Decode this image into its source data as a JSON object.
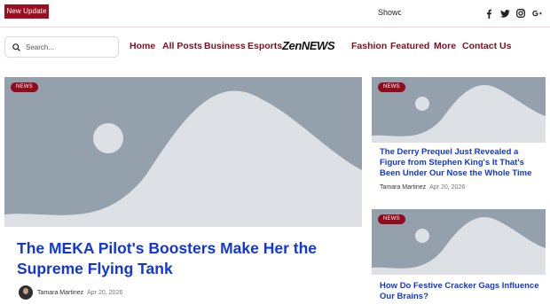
{
  "topbar": {
    "update_label": "New Update",
    "ticker_text": "Showc",
    "socials": [
      "facebook-icon",
      "twitter-icon",
      "instagram-icon",
      "google-plus-icon"
    ]
  },
  "search": {
    "placeholder": "Search..."
  },
  "nav": {
    "items": [
      "Home",
      "All Posts",
      "Business",
      "Esports",
      "Fashion",
      "Featured",
      "More",
      "Contact Us"
    ],
    "logo_text": "ZenNEWS"
  },
  "colors": {
    "brand": "#9b0d1f",
    "nav_text": "#7e0f22",
    "headline": "#1237d6",
    "placeholder_bg": "#94a0ab",
    "placeholder_shape": "#dde1e6"
  },
  "posts": {
    "main": {
      "badge": "NEWS",
      "title": "The MEKA Pilot's Boosters Make Her the Supreme Flying Tank",
      "author": "Tamara Martinez",
      "date": "Apr 20, 2026"
    },
    "side": [
      {
        "badge": "NEWS",
        "title": "The Derry Prequel Just Revealed a Figure from Stephen King's It That's Been Under Our Nose the Whole Time",
        "author": "Tamara Martinez",
        "date": "Apr 20, 2026"
      },
      {
        "badge": "NEWS",
        "title": "How Do Festive Cracker Gags Influence Our Brains?"
      }
    ]
  }
}
